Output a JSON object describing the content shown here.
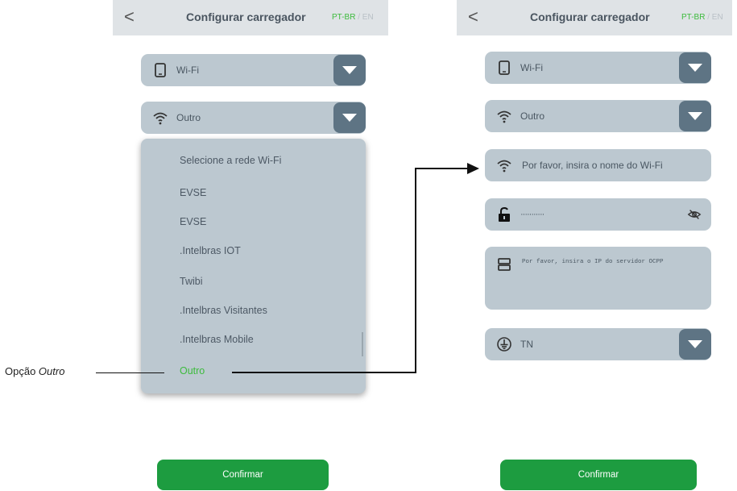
{
  "left_screen": {
    "header": {
      "back_label": "<",
      "title": "Configurar carregador",
      "lang_active": "PT-BR",
      "lang_sep": "/",
      "lang_inactive": "EN"
    },
    "connection_select": {
      "icon": "phone-icon",
      "value": "Wi-Fi"
    },
    "network_select": {
      "icon": "wifi-icon",
      "value": "Outro"
    },
    "network_options": [
      "Selecione a rede Wi-Fi",
      "EVSE",
      "EVSE",
      ".Intelbras IOT",
      "Twibi",
      ".Intelbras Visitantes",
      ".Intelbras Mobile",
      "Outro"
    ],
    "selected_option": "Outro",
    "confirm_label": "Confirmar"
  },
  "right_screen": {
    "header": {
      "back_label": "<",
      "title": "Configurar carregador",
      "lang_active": "PT-BR",
      "lang_sep": "/",
      "lang_inactive": "EN"
    },
    "connection_select": {
      "icon": "phone-icon",
      "value": "Wi-Fi"
    },
    "network_select": {
      "icon": "wifi-icon",
      "value": "Outro"
    },
    "wifi_name_input": {
      "icon": "wifi-icon",
      "placeholder": "Por favor, insira o nome do Wi-Fi"
    },
    "password_input": {
      "icon": "lock-icon",
      "value": "···········",
      "toggle_icon": "eye-off-icon"
    },
    "server_ip_input": {
      "icon": "server-icon",
      "placeholder": "Por favor, insira o IP do servidor OCPP"
    },
    "grounding_select": {
      "icon": "ground-icon",
      "value": "TN"
    },
    "confirm_label": "Confirmar"
  },
  "annotation": {
    "label_prefix": "Opção ",
    "label_emphasis": "Outro"
  },
  "colors": {
    "accent_green": "#1d9c40",
    "field_bg": "#bcc8d0",
    "dropdown_button": "#5e7484",
    "header_bg": "#dfe3e6"
  }
}
